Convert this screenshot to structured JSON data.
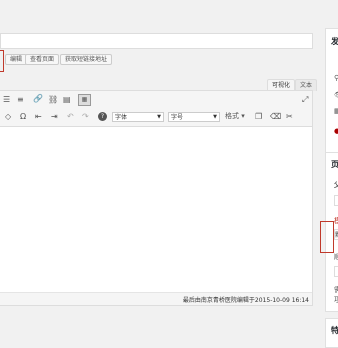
{
  "permalink": {
    "edit_label": "编辑",
    "view_label": "查看页面",
    "shortlink_label": "获取短链接地址"
  },
  "editor_tabs": {
    "visual": "可视化",
    "text": "文本"
  },
  "toolbar": {
    "font_family": "字体",
    "font_size": "字号",
    "format": "格式"
  },
  "status": {
    "last_edited": "最后由南京青桥医院编辑于2015-10-09 16:14"
  },
  "sidebar": {
    "publish_box_title": "发",
    "attributes_box_title": "页",
    "attributes_label": "父",
    "order_label": "模",
    "order_value": "默",
    "help_text_1": "需",
    "help_text_2": "项",
    "featured_box_title": "特"
  },
  "colors": {
    "highlight": "#c0392b",
    "editor_bg": "#ffffff",
    "toolbar_bg": "#f5f5f5",
    "page_bg": "#f1f1f1"
  },
  "icons": [
    "align-center-icon",
    "align-right-icon",
    "link-icon",
    "unlink-icon",
    "read-more-icon",
    "toolbar-toggle-icon",
    "fullscreen-icon",
    "eraser-icon",
    "special-char-icon",
    "outdent-icon",
    "indent-icon",
    "undo-icon",
    "redo-icon",
    "help-icon",
    "paste-text-icon",
    "remove-format-icon"
  ]
}
